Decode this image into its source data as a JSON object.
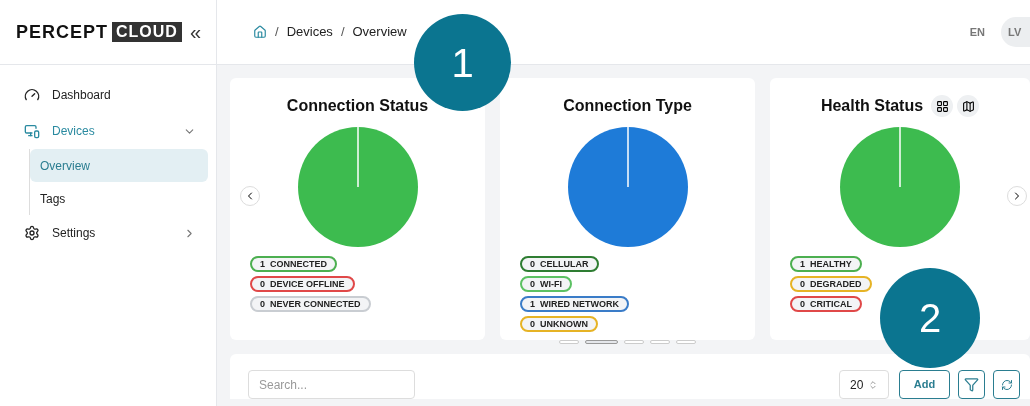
{
  "logo": {
    "word": "PERCEPT",
    "badge": "CLOUD",
    "collapse": "«"
  },
  "sidebar": {
    "items": [
      {
        "label": "Dashboard",
        "selected": false
      },
      {
        "label": "Devices",
        "expanded": true,
        "selected": true,
        "children": [
          {
            "label": "Overview",
            "selected": true
          },
          {
            "label": "Tags",
            "selected": false
          }
        ]
      },
      {
        "label": "Settings",
        "expanded": false,
        "selected": false
      }
    ]
  },
  "breadcrumb": {
    "separator": "/",
    "items": [
      "Devices",
      "Overview"
    ]
  },
  "header": {
    "language": "EN",
    "avatar": "LV"
  },
  "cards": [
    {
      "title": "Connection Status",
      "color": "#3dbb4f",
      "tools": false,
      "chips": [
        {
          "count": "1",
          "label": "CONNECTED",
          "color": "#4caf50"
        },
        {
          "count": "0",
          "label": "DEVICE OFFLINE",
          "color": "#e04848"
        },
        {
          "count": "0",
          "label": "NEVER CONNECTED",
          "color": "#c9cdd2"
        }
      ]
    },
    {
      "title": "Connection Type",
      "color": "#1e7bd8",
      "tools": false,
      "chips": [
        {
          "count": "0",
          "label": "CELLULAR",
          "color": "#2e7d32"
        },
        {
          "count": "0",
          "label": "WI-FI",
          "color": "#5cc163"
        },
        {
          "count": "1",
          "label": "WIRED NETWORK",
          "color": "#3a7cc8"
        },
        {
          "count": "0",
          "label": "UNKNOWN",
          "color": "#e6b325"
        }
      ]
    },
    {
      "title": "Health Status",
      "color": "#3dbb4f",
      "tools": true,
      "chips": [
        {
          "count": "1",
          "label": "HEALTHY",
          "color": "#4caf50"
        },
        {
          "count": "0",
          "label": "DEGRADED",
          "color": "#e6b325"
        },
        {
          "count": "0",
          "label": "CRITICAL",
          "color": "#e04848"
        }
      ]
    }
  ],
  "carousel_dots": [
    {
      "selected": false
    },
    {
      "selected": true
    },
    {
      "selected": false
    },
    {
      "selected": false
    },
    {
      "selected": false
    }
  ],
  "toolbar": {
    "search_placeholder": "Search...",
    "page_size": "20",
    "add": "Add"
  },
  "callouts": [
    "1",
    "2"
  ]
}
